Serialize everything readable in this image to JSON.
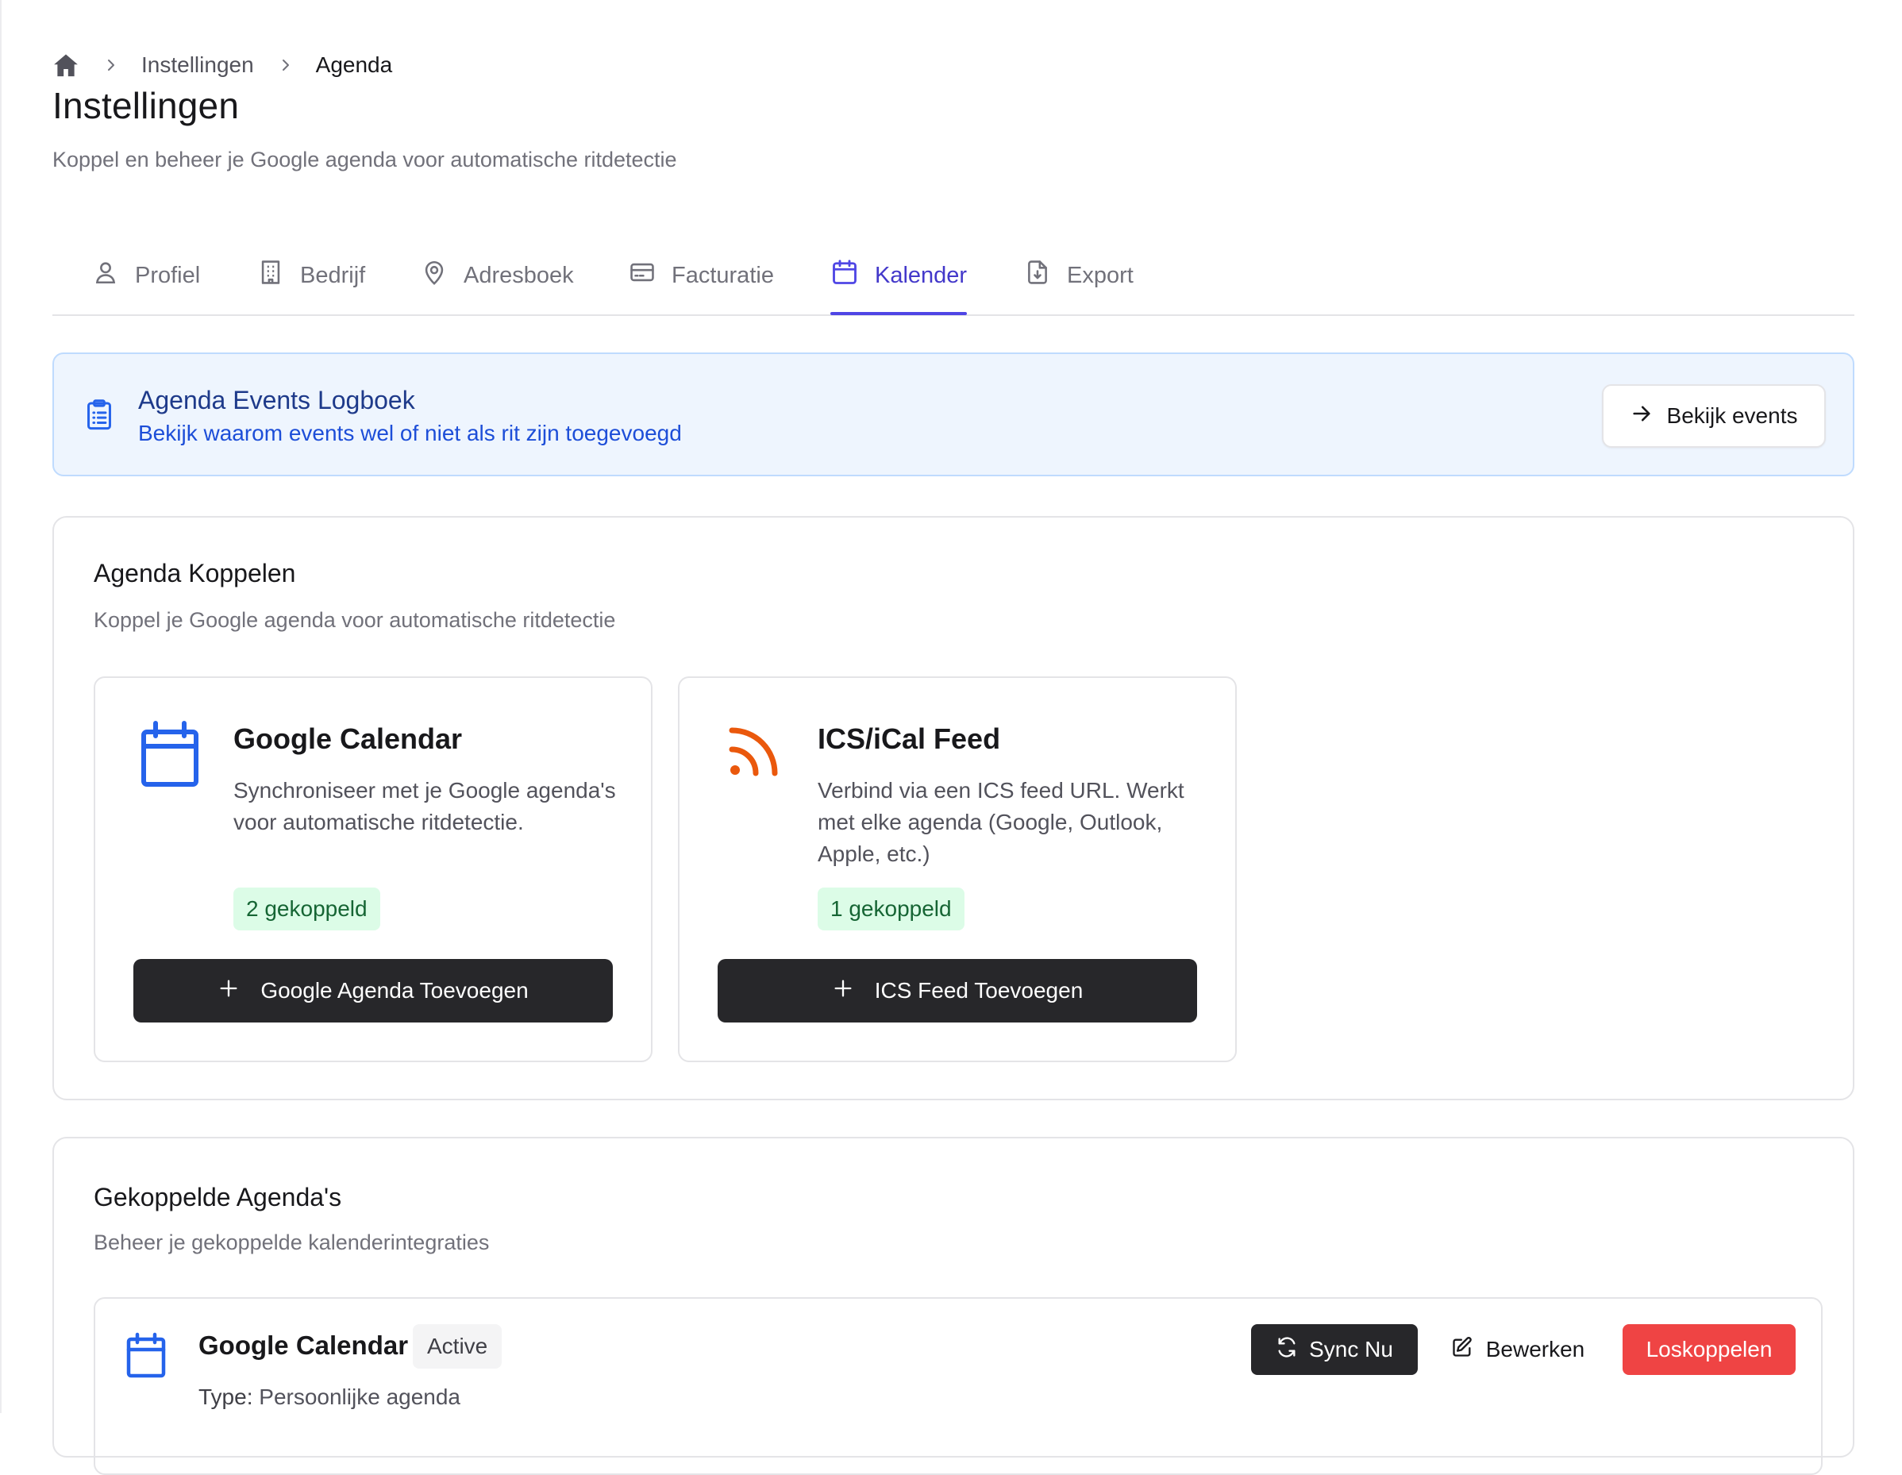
{
  "breadcrumb": {
    "items": [
      "Instellingen",
      "Agenda"
    ]
  },
  "page": {
    "title": "Instellingen",
    "subtitle": "Koppel en beheer je Google agenda voor automatische ritdetectie"
  },
  "tabs": [
    {
      "label": "Profiel",
      "icon": "user-icon"
    },
    {
      "label": "Bedrijf",
      "icon": "building-icon"
    },
    {
      "label": "Adresboek",
      "icon": "map-pin-icon"
    },
    {
      "label": "Facturatie",
      "icon": "credit-card-icon"
    },
    {
      "label": "Kalender",
      "icon": "calendar-icon",
      "active": true
    },
    {
      "label": "Export",
      "icon": "file-download-icon"
    }
  ],
  "banner": {
    "title": "Agenda Events Logboek",
    "subtitle": "Bekijk waarom events wel of niet als rit zijn toegevoegd",
    "button_label": "Bekijk events"
  },
  "connect_card": {
    "title": "Agenda Koppelen",
    "subtitle": "Koppel je Google agenda voor automatische ritdetectie",
    "providers": [
      {
        "title": "Google Calendar",
        "description": "Synchroniseer met je Google agenda's voor automatische ritdetectie.",
        "badge": "2 gekoppeld",
        "button_label": "Google Agenda Toevoegen"
      },
      {
        "title": "ICS/iCal Feed",
        "description": "Verbind via een ICS feed URL. Werkt met elke agenda (Google, Outlook, Apple, etc.)",
        "badge": "1 gekoppeld",
        "button_label": "ICS Feed Toevoegen"
      }
    ]
  },
  "linked_card": {
    "title": "Gekoppelde Agenda's",
    "subtitle": "Beheer je gekoppelde kalenderintegraties",
    "items": [
      {
        "name": "Google Calendar",
        "status": "Active",
        "type_label": "Type:",
        "type_value": "Persoonlijke agenda",
        "sync_label": "Sync Nu",
        "edit_label": "Bewerken",
        "unlink_label": "Loskoppelen"
      }
    ]
  },
  "colors": {
    "accent": "#4f46e5",
    "google_blue": "#2563eb",
    "rss_orange": "#ea580c",
    "badge_green_bg": "#dcfce7",
    "badge_green_text": "#166534",
    "danger": "#ef4444",
    "dark_button": "#27272a"
  }
}
